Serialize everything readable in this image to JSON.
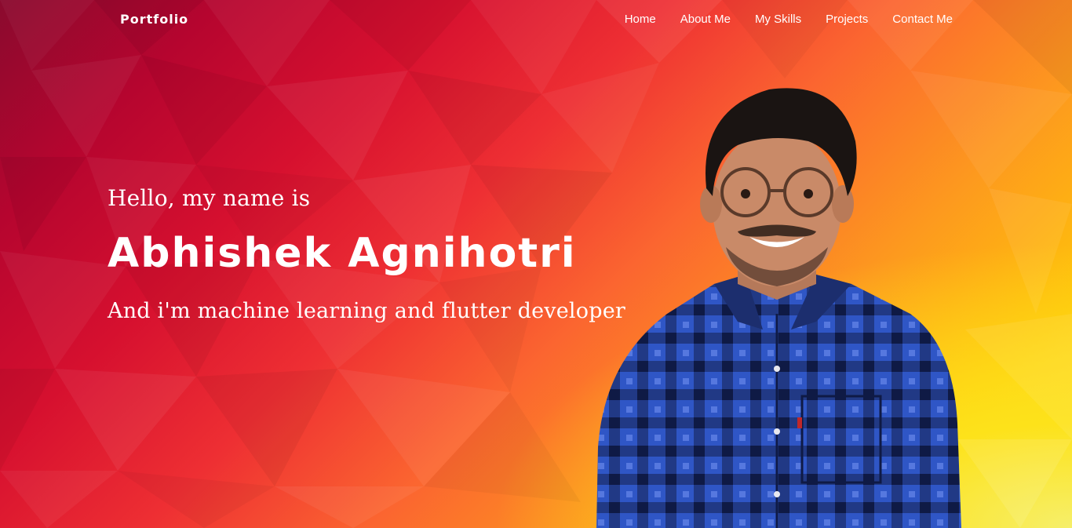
{
  "nav": {
    "brand": "Portfolio",
    "items": [
      {
        "label": "Home"
      },
      {
        "label": "About Me"
      },
      {
        "label": "My Skills"
      },
      {
        "label": "Projects"
      },
      {
        "label": "Contact Me"
      }
    ]
  },
  "hero": {
    "greeting": "Hello, my name is",
    "name": "Abhishek Agnihotri",
    "tagline": "And i'm machine learning and flutter developer"
  },
  "colors": {
    "bg_dark": "#8a0a2e",
    "bg_red": "#d6102f",
    "bg_orange": "#fb6530",
    "bg_yellow": "#ffe33a",
    "shirt_blue": "#2a4fc0",
    "text": "#ffffff"
  }
}
